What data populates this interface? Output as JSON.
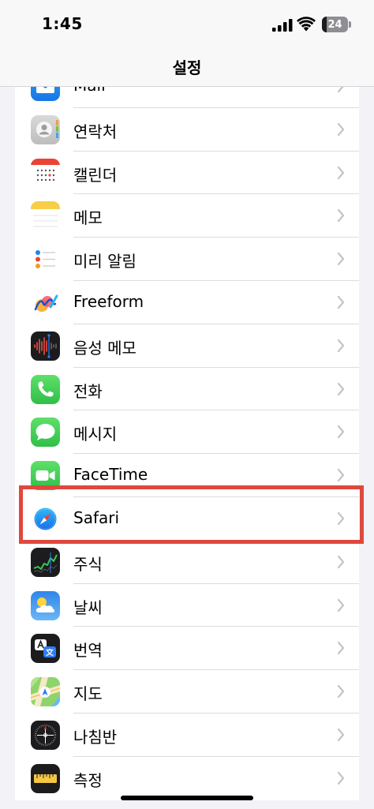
{
  "status_bar": {
    "time": "1:45",
    "battery_level": "24",
    "icons": [
      "signal-icon",
      "wifi-icon",
      "battery-icon"
    ]
  },
  "nav": {
    "title": "설정"
  },
  "settings_list": [
    {
      "label": "Mail",
      "icon": "mail-icon"
    },
    {
      "label": "연락처",
      "icon": "contacts-icon"
    },
    {
      "label": "캘린더",
      "icon": "calendar-icon"
    },
    {
      "label": "메모",
      "icon": "notes-icon"
    },
    {
      "label": "미리 알림",
      "icon": "reminders-icon"
    },
    {
      "label": "Freeform",
      "icon": "freeform-icon"
    },
    {
      "label": "음성 메모",
      "icon": "voice-memos-icon"
    },
    {
      "label": "전화",
      "icon": "phone-icon"
    },
    {
      "label": "메시지",
      "icon": "messages-icon"
    },
    {
      "label": "FaceTime",
      "icon": "facetime-icon"
    },
    {
      "label": "Safari",
      "icon": "safari-icon",
      "highlighted": true
    },
    {
      "label": "주식",
      "icon": "stocks-icon"
    },
    {
      "label": "날씨",
      "icon": "weather-icon"
    },
    {
      "label": "번역",
      "icon": "translate-icon"
    },
    {
      "label": "지도",
      "icon": "maps-icon"
    },
    {
      "label": "나침반",
      "icon": "compass-icon"
    },
    {
      "label": "측정",
      "icon": "measure-icon"
    }
  ],
  "colors": {
    "highlight_border": "#e0483e",
    "background": "#f2f2f7",
    "chevron": "#c4c4c7"
  }
}
